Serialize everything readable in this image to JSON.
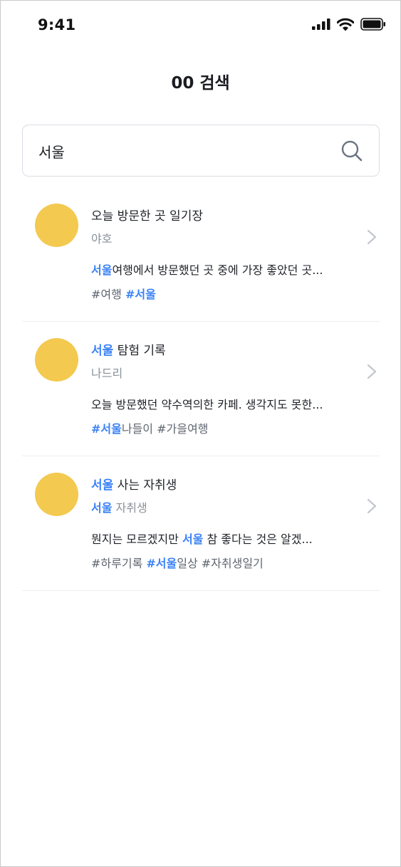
{
  "status_bar": {
    "time": "9:41"
  },
  "header": {
    "title": "00 검색"
  },
  "search": {
    "value": "서울",
    "query": "서울"
  },
  "results": [
    {
      "title": "오늘 방문한 곳 일기장",
      "author": "야호",
      "excerpt": "서울여행에서 방문했던 곳 중에 가장 좋았던 곳...",
      "tags": "#여행 #서울"
    },
    {
      "title": "서울 탐험 기록",
      "author": "나드리",
      "excerpt": "오늘 방문했던 약수역의한 카페. 생각지도 못한...",
      "tags": "#서울나들이 #가을여행"
    },
    {
      "title": "서울 사는 자취생",
      "author": "서울 자취생",
      "excerpt": "뭔지는 모르겠지만 서울 참 좋다는 것은 알겠...",
      "tags": "#하루기록 #서울일상 #자취생일기"
    }
  ],
  "colors": {
    "highlight": "#3b82f6",
    "avatar": "#f3c94f",
    "muted_text": "#8a919c",
    "divider": "#eceef1"
  },
  "icons": {
    "signal": "signal-icon",
    "wifi": "wifi-icon",
    "battery": "battery-icon",
    "search": "search-icon",
    "chevron": "chevron-right-icon"
  }
}
